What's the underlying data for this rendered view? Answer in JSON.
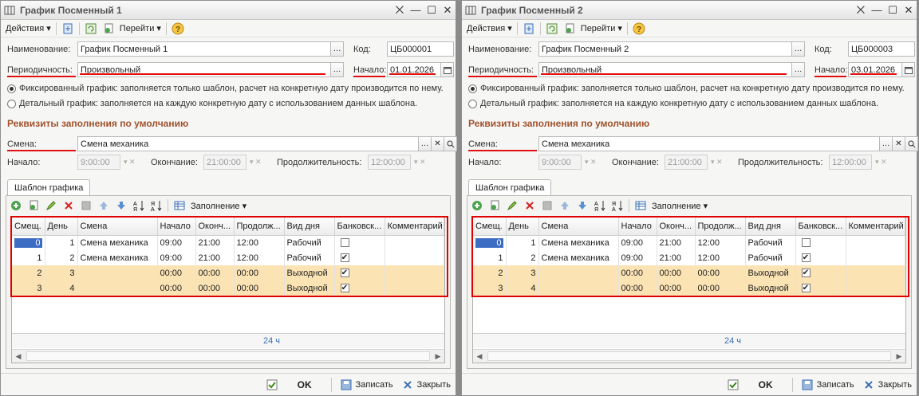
{
  "toolbar": {
    "actions_label": "Действия",
    "goto_label": "Перейти",
    "help_label": "?"
  },
  "labels": {
    "name": "Наименование:",
    "code": "Код:",
    "period": "Периодичность:",
    "start_date": "Начало:",
    "fixed_option": "Фиксированный график: заполняется только шаблон, расчет на конкретную дату производится по нему.",
    "detail_option": "Детальный график: заполняется на каждую конкретную дату с использованием данных шаблона.",
    "section": "Реквизиты заполнения по умолчанию",
    "shift": "Смена:",
    "start_time": "Начало:",
    "end_time": "Окончание:",
    "duration": "Продолжительность:",
    "tab": "Шаблон графика",
    "fill": "Заполнение",
    "ok": "OK",
    "save": "Записать",
    "close": "Закрыть"
  },
  "columns": [
    "Смещ.",
    "День",
    "Смена",
    "Начало",
    "Оконч...",
    "Продолж...",
    "Вид дня",
    "Банковск...",
    "Комментарий"
  ],
  "windows": [
    {
      "title": "График Посменный 1",
      "name": "График Посменный 1",
      "code": "ЦБ000001",
      "period": "Произвольный",
      "start_date": "01.01.2026",
      "shift": "Смена механика",
      "start_time": "9:00:00",
      "end_time": "21:00:00",
      "duration": "12:00:00",
      "total": "24 ч",
      "rows": [
        {
          "offset": "0",
          "day": "1",
          "shift": "Смена механика",
          "start": "09:00",
          "end": "21:00",
          "dur": "12:00",
          "kind": "Рабочий",
          "bank": false
        },
        {
          "offset": "1",
          "day": "2",
          "shift": "Смена механика",
          "start": "09:00",
          "end": "21:00",
          "dur": "12:00",
          "kind": "Рабочий",
          "bank": true
        },
        {
          "offset": "2",
          "day": "3",
          "shift": "",
          "start": "00:00",
          "end": "00:00",
          "dur": "00:00",
          "kind": "Выходной",
          "bank": true
        },
        {
          "offset": "3",
          "day": "4",
          "shift": "",
          "start": "00:00",
          "end": "00:00",
          "dur": "00:00",
          "kind": "Выходной",
          "bank": true
        }
      ]
    },
    {
      "title": "График Посменный 2",
      "name": "График Посменный 2",
      "code": "ЦБ000003",
      "period": "Произвольный",
      "start_date": "03.01.2026",
      "shift": "Смена механика",
      "start_time": "9:00:00",
      "end_time": "21:00:00",
      "duration": "12:00:00",
      "total": "24 ч",
      "rows": [
        {
          "offset": "0",
          "day": "1",
          "shift": "Смена механика",
          "start": "09:00",
          "end": "21:00",
          "dur": "12:00",
          "kind": "Рабочий",
          "bank": false
        },
        {
          "offset": "1",
          "day": "2",
          "shift": "Смена механика",
          "start": "09:00",
          "end": "21:00",
          "dur": "12:00",
          "kind": "Рабочий",
          "bank": true
        },
        {
          "offset": "2",
          "day": "3",
          "shift": "",
          "start": "00:00",
          "end": "00:00",
          "dur": "00:00",
          "kind": "Выходной",
          "bank": true
        },
        {
          "offset": "3",
          "day": "4",
          "shift": "",
          "start": "00:00",
          "end": "00:00",
          "dur": "00:00",
          "kind": "Выходной",
          "bank": true
        }
      ]
    }
  ]
}
